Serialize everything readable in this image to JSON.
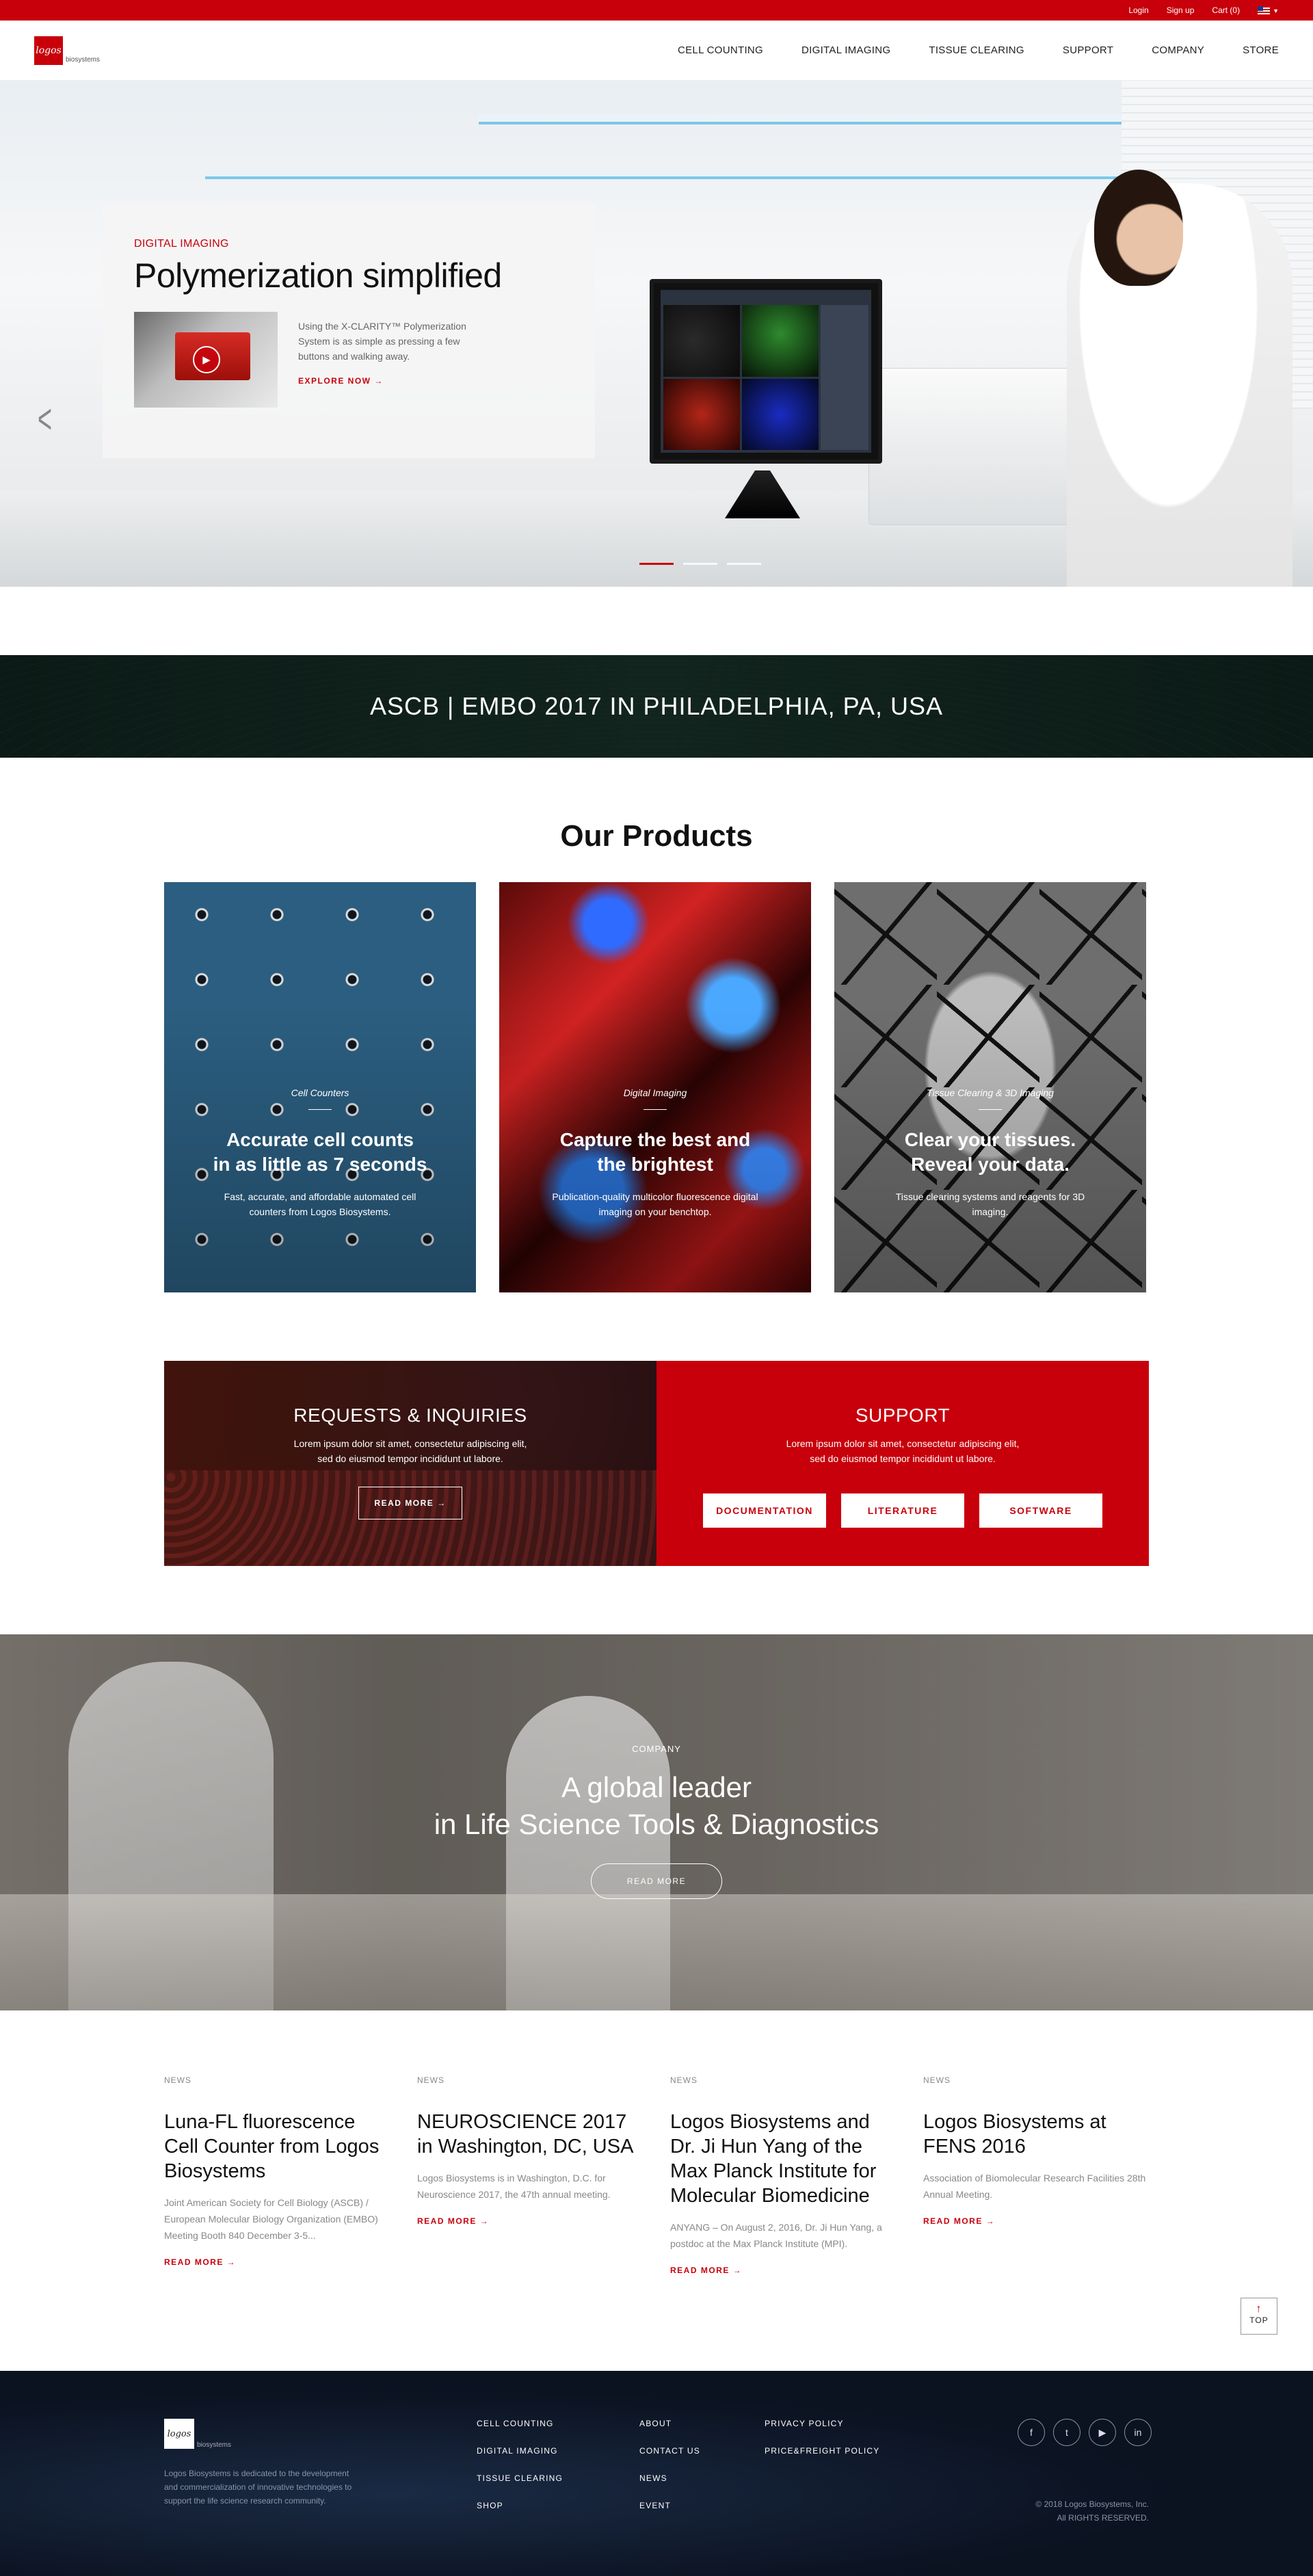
{
  "topbar": {
    "login": "Login",
    "signup": "Sign up",
    "cart": "Cart (0)"
  },
  "header": {
    "logo_text": "logos",
    "logo_sub": "biosystems",
    "nav": [
      "CELL COUNTING",
      "DIGITAL IMAGING",
      "TISSUE CLEARING",
      "SUPPORT",
      "COMPANY",
      "STORE"
    ]
  },
  "hero": {
    "eyebrow": "DIGITAL IMAGING",
    "title": "Polymerization simplified",
    "body": "Using the X-CLARITY™ Polymerization System is as simple as pressing a few buttons and walking away.",
    "cta": "EXPLORE NOW  →"
  },
  "event": {
    "text": "ASCB | EMBO 2017 IN PHILADELPHIA, PA, USA"
  },
  "products": {
    "title": "Our Products",
    "cards": [
      {
        "category": "Cell Counters",
        "title_l1": "Accurate cell counts",
        "title_l2": "in as little as 7 seconds",
        "desc": "Fast, accurate, and affordable automated cell counters from Logos Biosystems."
      },
      {
        "category": "Digital Imaging",
        "title_l1": "Capture the best and",
        "title_l2": "the brightest",
        "desc": "Publication-quality multicolor fluorescence digital imaging on your benchtop."
      },
      {
        "category": "Tissue Clearing & 3D Imaging",
        "title_l1": "Clear your tissues.",
        "title_l2": "Reveal your data.",
        "desc": "Tissue clearing systems and reagents for 3D imaging."
      }
    ]
  },
  "requests": {
    "title": "REQUESTS & INQUIRIES",
    "text": "Lorem ipsum dolor sit amet, consectetur adipiscing elit, sed do eiusmod tempor incididunt ut labore.",
    "cta": "READ MORE  →"
  },
  "support": {
    "title": "SUPPORT",
    "text": "Lorem ipsum dolor sit amet, consectetur adipiscing elit, sed do eiusmod tempor incididunt ut labore.",
    "buttons": [
      "DOCUMENTATION",
      "LITERATURE",
      "SOFTWARE"
    ]
  },
  "company": {
    "eyebrow": "COMPANY",
    "title_l1": "A global leader",
    "title_l2": "in Life Science Tools & Diagnostics",
    "cta": "READ MORE"
  },
  "news": [
    {
      "tag": "NEWS",
      "title": "Luna-FL fluorescence Cell Counter from Logos Biosystems",
      "text": "Joint American Society for Cell Biology (ASCB) / European Molecular Biology Organization (EMBO) Meeting Booth 840 December 3-5...",
      "more": "READ MORE  →"
    },
    {
      "tag": "NEWS",
      "title": "NEUROSCIENCE 2017 in Washington, DC, USA",
      "text": "Logos Biosystems is in Washington, D.C. for Neuroscience 2017, the 47th annual meeting.",
      "more": "READ MORE  →"
    },
    {
      "tag": "NEWS",
      "title": "Logos Biosystems and Dr. Ji Hun Yang of the Max Planck Institute for Molecular Biomedicine",
      "text": "ANYANG – On August 2, 2016, Dr. Ji Hun Yang, a postdoc at the Max Planck Institute (MPI).",
      "more": "READ MORE  →"
    },
    {
      "tag": "NEWS",
      "title": "Logos Biosystems at FENS 2016",
      "text": "Association of Biomolecular Research Facilities 28th Annual Meeting.",
      "more": "READ MORE  →"
    }
  ],
  "top_button": "TOP",
  "footer": {
    "logo_text": "logos",
    "logo_sub": "biosystems",
    "description": "Logos Biosystems is dedicated to the development and commercialization of innovative technologies to support the life science research community.",
    "col1": [
      "CELL COUNTING",
      "DIGITAL IMAGING",
      "TISSUE CLEARING",
      "SHOP"
    ],
    "col2": [
      "ABOUT",
      "CONTACT US",
      "NEWS",
      "EVENT"
    ],
    "col3": [
      "PRIVACY POLICY",
      "PRICE&FREIGHT POLICY"
    ],
    "social": [
      "f",
      "t",
      "▶",
      "in"
    ],
    "copyright_l1": "©  2018 Logos Biosystems, Inc.",
    "copyright_l2": "All RIGHTS RESERVED."
  },
  "icons": {
    "flag": "us-flag-icon",
    "play": "play-icon",
    "slider_prev": "chevron-left-icon",
    "social": [
      "facebook-icon",
      "twitter-icon",
      "youtube-icon",
      "linkedin-icon"
    ]
  },
  "colors": {
    "brand_red": "#c8000b",
    "footer_bg": "#0b1220",
    "event_bg": "#0b1a16"
  }
}
